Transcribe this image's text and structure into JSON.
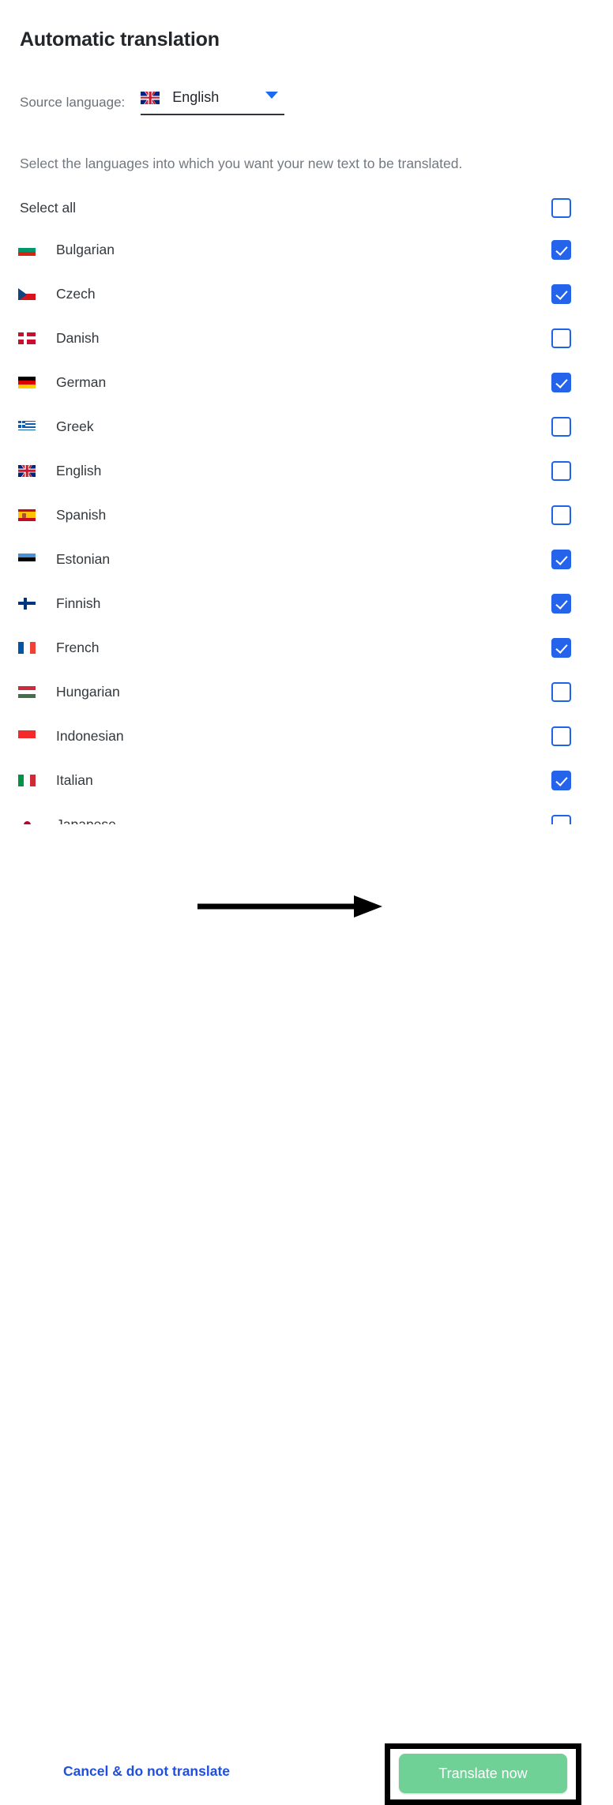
{
  "header": {
    "title": "Automatic translation"
  },
  "source": {
    "label": "Source language:",
    "value": "English",
    "flag": "flag-gb",
    "chevron_icon": "chevron-down-icon"
  },
  "instruction": "Select the languages into which you want your new text to be translated.",
  "select_all": {
    "label": "Select all",
    "checked": false
  },
  "languages": [
    {
      "label": "Bulgarian",
      "flag": "flag-bg",
      "checked": true
    },
    {
      "label": "Czech",
      "flag": "flag-cz",
      "checked": true
    },
    {
      "label": "Danish",
      "flag": "flag-dk",
      "checked": false
    },
    {
      "label": "German",
      "flag": "flag-de",
      "checked": true
    },
    {
      "label": "Greek",
      "flag": "flag-gr",
      "checked": false
    },
    {
      "label": "English",
      "flag": "flag-gb",
      "checked": false
    },
    {
      "label": "Spanish",
      "flag": "flag-es",
      "checked": false
    },
    {
      "label": "Estonian",
      "flag": "flag-ee",
      "checked": true
    },
    {
      "label": "Finnish",
      "flag": "flag-fi",
      "checked": true
    },
    {
      "label": "French",
      "flag": "flag-fr",
      "checked": true
    },
    {
      "label": "Hungarian",
      "flag": "flag-hu",
      "checked": false
    },
    {
      "label": "Indonesian",
      "flag": "flag-id",
      "checked": false
    },
    {
      "label": "Italian",
      "flag": "flag-it",
      "checked": true
    },
    {
      "label": "Japanese",
      "flag": "flag-jp",
      "checked": false
    }
  ],
  "footer": {
    "cancel_label": "Cancel & do not translate",
    "translate_label": "Translate now",
    "annotation_arrow_icon": "arrow-right-icon"
  },
  "colors": {
    "accent_blue": "#2563eb",
    "link_blue": "#1f4fe0",
    "translate_green": "#6fd195",
    "highlight_outline": "#000000"
  }
}
